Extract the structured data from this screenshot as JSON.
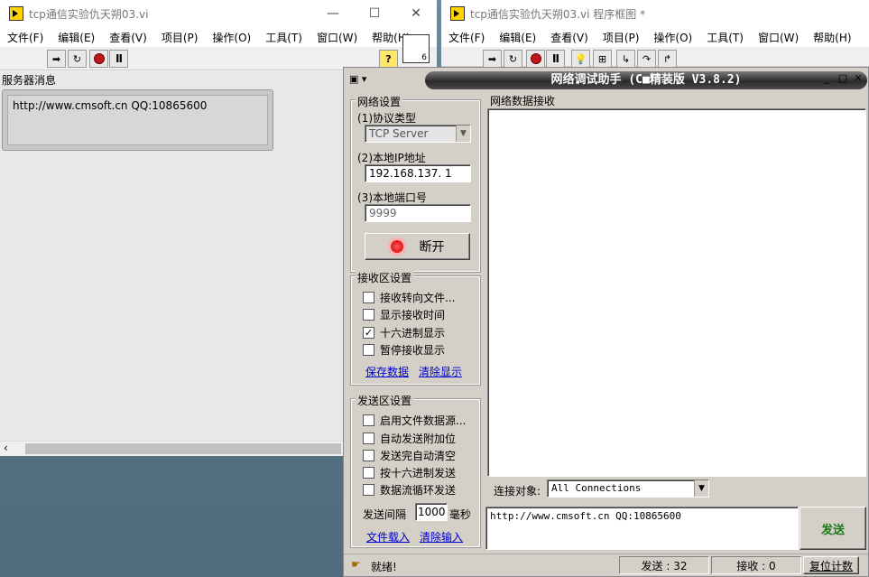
{
  "left_window": {
    "title": "tcp通信实验仇天朔03.vi",
    "menu": [
      "文件(F)",
      "编辑(E)",
      "查看(V)",
      "项目(P)",
      "操作(O)",
      "工具(T)",
      "窗口(W)",
      "帮助(H)"
    ],
    "panel_label": "服务器消息",
    "message": "http://www.cmsoft.cn QQ:10865600"
  },
  "right_window": {
    "title": "tcp通信实验仇天朔03.vi 程序框图 *",
    "menu": [
      "文件(F)",
      "编辑(E)",
      "查看(V)",
      "项目(P)",
      "操作(O)",
      "工具(T)",
      "窗口(W)",
      "帮助(H)"
    ]
  },
  "tool": {
    "title": "网络调试助手 (C■精装版 V3.8.2)",
    "net_settings": {
      "label": "网络设置",
      "protocol_label": "(1)协议类型",
      "protocol_value": "TCP Server",
      "ip_label": "(2)本地IP地址",
      "ip_value": "192.168.137. 1",
      "port_label": "(3)本地端口号",
      "port_value": "9999",
      "disconnect_label": "断开"
    },
    "recv_settings": {
      "label": "接收区设置",
      "options": [
        {
          "label": "接收转向文件...",
          "checked": ""
        },
        {
          "label": "显示接收时间",
          "checked": ""
        },
        {
          "label": "十六进制显示",
          "checked": "✓"
        },
        {
          "label": "暂停接收显示",
          "checked": ""
        }
      ],
      "save_link": "保存数据",
      "clear_link": "清除显示"
    },
    "send_settings": {
      "label": "发送区设置",
      "options": [
        {
          "label": "启用文件数据源...",
          "checked": ""
        },
        {
          "label": "自动发送附加位",
          "checked": ""
        },
        {
          "label": "发送完自动清空",
          "checked": ""
        },
        {
          "label": "按十六进制发送",
          "checked": ""
        },
        {
          "label": "数据流循环发送",
          "checked": ""
        }
      ],
      "interval_label": "发送间隔",
      "interval_value": "1000",
      "interval_unit": "毫秒",
      "load_link": "文件载入",
      "clear_link": "清除输入"
    },
    "recv_area_label": "网络数据接收",
    "connect_label": "连接对象:",
    "connect_value": "All Connections",
    "send_text": "http://www.cmsoft.cn QQ:10865600",
    "send_button": "发送",
    "status": {
      "ready": "就绪!",
      "sent": "发送 : 32",
      "received": "接收 : 0",
      "reset": "复位计数"
    }
  },
  "colors": {
    "tool_bg": "#d4d0c8",
    "link": "#0000cc",
    "stop": "#c3161c"
  }
}
